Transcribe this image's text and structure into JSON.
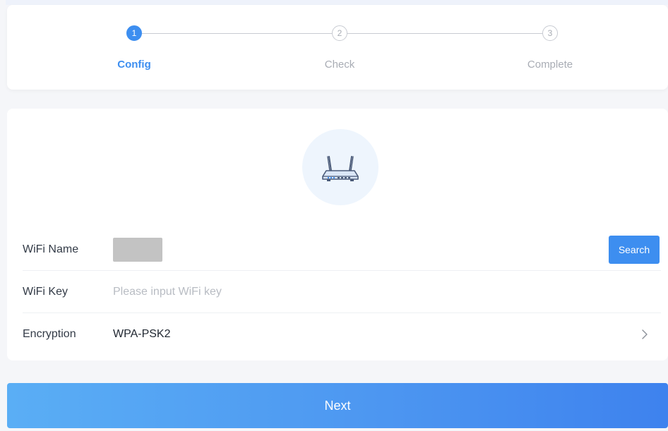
{
  "stepper": {
    "steps": [
      {
        "number": "1",
        "label": "Config",
        "state": "active"
      },
      {
        "number": "2",
        "label": "Check",
        "state": "inactive"
      },
      {
        "number": "3",
        "label": "Complete",
        "state": "inactive"
      }
    ]
  },
  "form": {
    "router_icon": "router-icon",
    "wifi_name": {
      "label": "WiFi Name",
      "value_masked": true,
      "search_label": "Search"
    },
    "wifi_key": {
      "label": "WiFi Key",
      "value": "",
      "placeholder": "Please input WiFi key"
    },
    "encryption": {
      "label": "Encryption",
      "value": "WPA-PSK2",
      "chevron_icon": "chevron-right-icon"
    }
  },
  "footer": {
    "next_label": "Next"
  },
  "colors": {
    "accent": "#3d8ef0",
    "inactive": "#a8acb4",
    "background": "#f5f6f9",
    "router_bg": "#eef5fd"
  }
}
